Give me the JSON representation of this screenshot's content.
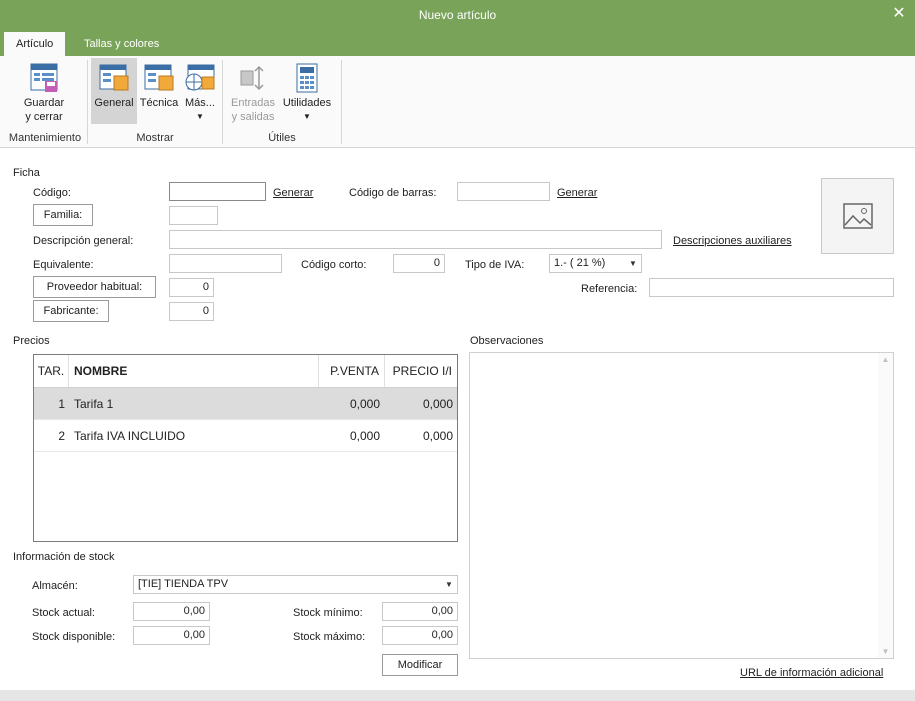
{
  "window": {
    "title": "Nuevo artículo"
  },
  "tabs": [
    {
      "label": "Artículo",
      "active": true
    },
    {
      "label": "Tallas y colores",
      "active": false
    }
  ],
  "ribbon": {
    "groups": {
      "mantenimiento": "Mantenimiento",
      "mostrar": "Mostrar",
      "utiles": "Útiles"
    },
    "buttons": {
      "guardar_1": "Guardar",
      "guardar_2": "y cerrar",
      "general": "General",
      "tecnica": "Técnica",
      "mas": "Más...",
      "entradas_1": "Entradas",
      "entradas_2": "y salidas",
      "utilidades": "Utilidades"
    }
  },
  "ficha": {
    "section": "Ficha",
    "codigo_label": "Código:",
    "codigo_value": "",
    "generar": "Generar",
    "codigo_barras_label": "Código de barras:",
    "codigo_barras_value": "",
    "generar_barras": "Generar",
    "familia": "Familia:",
    "familia_value": "",
    "descripcion_label": "Descripción general:",
    "descripcion_value": "",
    "descripciones_auxiliares": "Descripciones auxiliares",
    "equivalente_label": "Equivalente:",
    "equivalente_value": "",
    "codigo_corto_label": "Código corto:",
    "codigo_corto_value": "0",
    "tipo_iva_label": "Tipo de IVA:",
    "tipo_iva_value": "1.- ( 21 %)",
    "proveedor": "Proveedor habitual:",
    "proveedor_value": "0",
    "referencia_label": "Referencia:",
    "referencia_value": "",
    "fabricante": "Fabricante:",
    "fabricante_value": "0"
  },
  "precios": {
    "section": "Precios",
    "columns": [
      "TAR.",
      "NOMBRE",
      "P.VENTA",
      "PRECIO I/I"
    ],
    "rows": [
      {
        "tar": "1",
        "nombre": "Tarifa 1",
        "pventa": "0,000",
        "precio_ii": "0,000",
        "selected": true
      },
      {
        "tar": "2",
        "nombre": "Tarifa IVA INCLUIDO",
        "pventa": "0,000",
        "precio_ii": "0,000",
        "selected": false
      }
    ]
  },
  "observaciones": {
    "section": "Observaciones",
    "value": ""
  },
  "stock": {
    "section": "Información de stock",
    "almacen_label": "Almacén:",
    "almacen_value": "[TIE] TIENDA TPV",
    "stock_actual_label": "Stock actual:",
    "stock_actual_value": "0,00",
    "stock_disponible_label": "Stock disponible:",
    "stock_disponible_value": "0,00",
    "stock_minimo_label": "Stock mínimo:",
    "stock_minimo_value": "0,00",
    "stock_maximo_label": "Stock máximo:",
    "stock_maximo_value": "0,00",
    "modificar": "Modificar"
  },
  "url_info": "URL de información adicional",
  "colors": {
    "titlebar": "#7aa35a",
    "selected_row": "#dcdcdc"
  }
}
